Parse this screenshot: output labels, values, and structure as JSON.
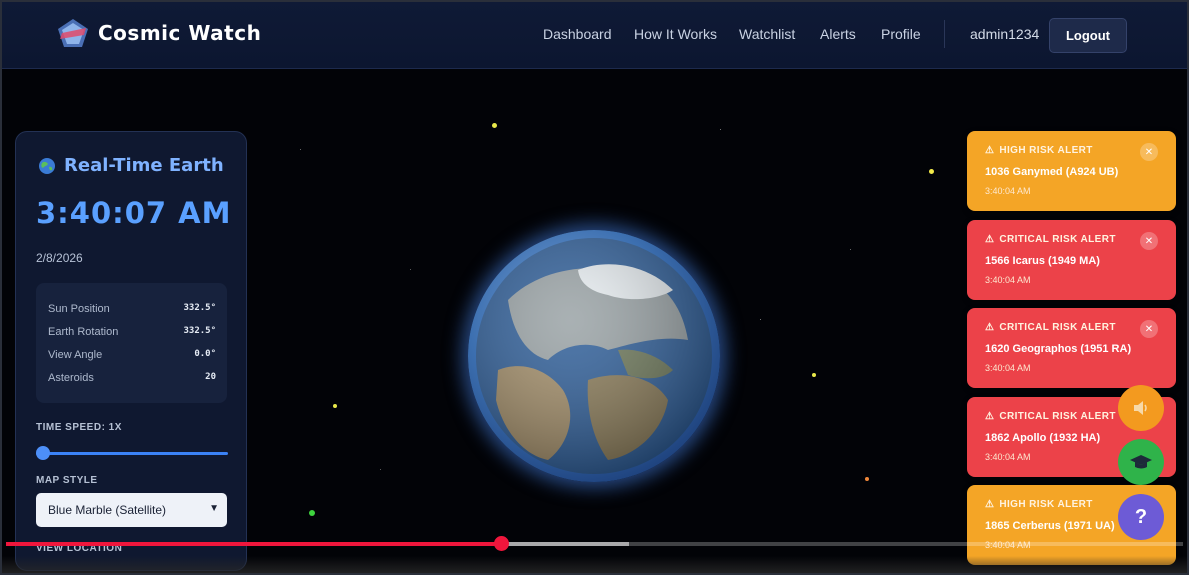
{
  "header": {
    "brand": "Cosmic Watch",
    "nav": [
      "Dashboard",
      "How It Works",
      "Watchlist",
      "Alerts",
      "Profile"
    ],
    "username": "admin1234",
    "logout_label": "Logout"
  },
  "panel": {
    "title": "Real-Time Earth",
    "time": "3:40:07 AM",
    "date": "2/8/2026",
    "stats": [
      {
        "label": "Sun Position",
        "value": "332.5°"
      },
      {
        "label": "Earth Rotation",
        "value": "332.5°"
      },
      {
        "label": "View Angle",
        "value": "0.0°"
      },
      {
        "label": "Asteroids",
        "value": "20"
      }
    ],
    "time_speed_label": "TIME SPEED: 1X",
    "time_speed_value": 1,
    "map_style_label": "MAP STYLE",
    "map_style_selected": "Blue Marble (Satellite)",
    "view_location_label": "VIEW LOCATION"
  },
  "alerts": [
    {
      "type": "HIGH RISK ALERT",
      "name": "1036 Ganymed (A924 UB)",
      "time": "3:40:04 AM",
      "level": "high"
    },
    {
      "type": "CRITICAL RISK ALERT",
      "name": "1566 Icarus (1949 MA)",
      "time": "3:40:04 AM",
      "level": "critical"
    },
    {
      "type": "CRITICAL RISK ALERT",
      "name": "1620 Geographos (1951 RA)",
      "time": "3:40:04 AM",
      "level": "critical"
    },
    {
      "type": "CRITICAL RISK ALERT",
      "name": "1862 Apollo (1932 HA)",
      "time": "3:40:04 AM",
      "level": "critical"
    },
    {
      "type": "HIGH RISK ALERT",
      "name": "1865 Cerberus (1971 UA)",
      "time": "3:40:04 AM",
      "level": "high"
    }
  ],
  "fabs": {
    "sound_icon": "speaker-icon",
    "learn_icon": "graduation-cap-icon",
    "help_label": "?"
  },
  "video": {
    "played_fraction": 0.42,
    "buffered_fraction": 0.53
  },
  "colors": {
    "accent": "#5aa0ff",
    "high": "#f4a526",
    "critical": "#ec4249",
    "progress": "#f0163c"
  }
}
